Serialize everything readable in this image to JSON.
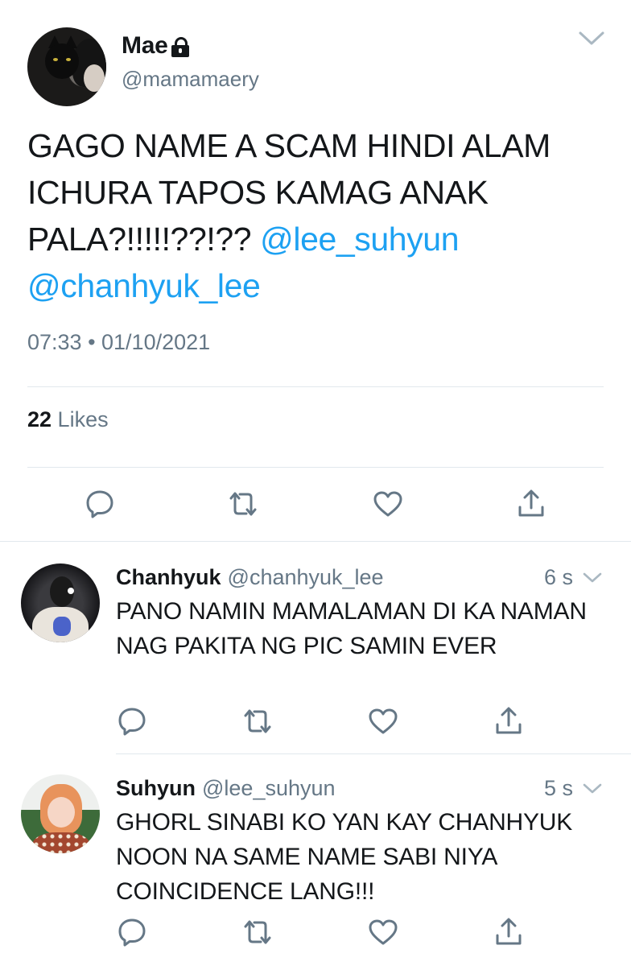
{
  "tweet": {
    "author_name": "Mae",
    "author_handle": "@mamamaery",
    "text_parts": {
      "body": "GAGO NAME A SCAM HINDI ALAM ICHURA TAPOS KAMAG ANAK PALA?!!!!!??!?? ",
      "mention1": "@lee_suhyun",
      "mention2": "@chanhyuk_lee"
    },
    "timestamp": "07:33 • 01/10/2021",
    "likes_count": "22",
    "likes_label": " Likes",
    "icons": {
      "lock": "lock-icon",
      "menu": "chevron-down-icon",
      "reply": "reply-icon",
      "retweet": "retweet-icon",
      "like": "heart-icon",
      "share": "share-icon"
    }
  },
  "replies": [
    {
      "name": "Chanhyuk",
      "handle": "@chanhyuk_lee",
      "time": "6 s",
      "text": "PANO NAMIN MAMALAMAN DI KA NAMAN NAG PAKITA NG PIC SAMIN EVER"
    },
    {
      "name": "Suhyun",
      "handle": "@lee_suhyun",
      "time": "5 s",
      "text": "GHORL SINABI KO YAN KAY CHANHYUK NOON NA SAME NAME SABI NIYA COINCIDENCE LANG!!!"
    }
  ],
  "colors": {
    "text": "#14171a",
    "secondary": "#657786",
    "mention": "#1da1f2",
    "divider": "#e1e8ed",
    "icon": "#657786"
  }
}
